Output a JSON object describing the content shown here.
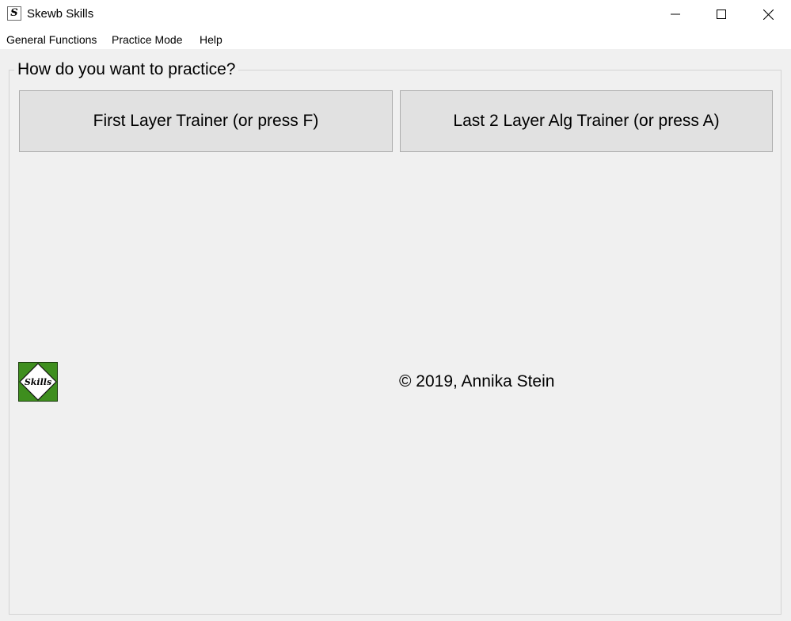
{
  "window": {
    "title": "Skewb Skills",
    "app_icon_glyph": "S",
    "controls": [
      "minimize-icon",
      "maximize-icon",
      "close-icon"
    ]
  },
  "menu": {
    "items": [
      {
        "label": "General Functions"
      },
      {
        "label": "Practice Mode"
      },
      {
        "label": "Help"
      }
    ]
  },
  "main": {
    "group_title": "How do you want to practice?",
    "buttons": {
      "first_layer": "First Layer Trainer (or press F)",
      "last_layer": "Last 2 Layer Alg Trainer (or press A)"
    },
    "logo": {
      "text": "Skills",
      "color": "#3e8e1e"
    },
    "copyright": "© 2019, Annika Stein"
  }
}
